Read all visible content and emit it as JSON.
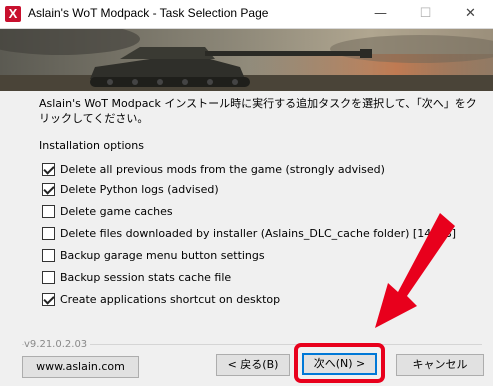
{
  "window": {
    "title": "Aslain's WoT Modpack - Task Selection Page",
    "app_icon_glyph": "X",
    "minimize_glyph": "—",
    "maximize_glyph": "☐",
    "close_glyph": "✕"
  },
  "instruction": "Aslain's WoT Modpack インストール時に実行する追加タスクを選択して、「次へ」をクリックしてください。",
  "group_label": "Installation options",
  "options": [
    {
      "label": "Delete all previous mods from the game (strongly advised)",
      "checked": true
    },
    {
      "label": "Delete Python logs (advised)",
      "checked": true
    },
    {
      "label": "Delete game caches",
      "checked": false
    },
    {
      "label": "Delete files downloaded by installer (Aslains_DLC_cache folder)  [14 MB]",
      "checked": false
    },
    {
      "label": "Backup garage menu button settings",
      "checked": false
    },
    {
      "label": "Backup session stats cache file",
      "checked": false
    },
    {
      "label": "Create applications shortcut on desktop",
      "checked": true
    }
  ],
  "footer": {
    "version": "v9.21.0.2.03",
    "website_button": "www.aslain.com",
    "back_button": "< 戻る(B)",
    "next_button": "次へ(N) >",
    "cancel_button": "キャンセル"
  },
  "colors": {
    "highlight": "#e8001c",
    "app_icon": "#c8102e",
    "default_button_border": "#0078d7"
  }
}
